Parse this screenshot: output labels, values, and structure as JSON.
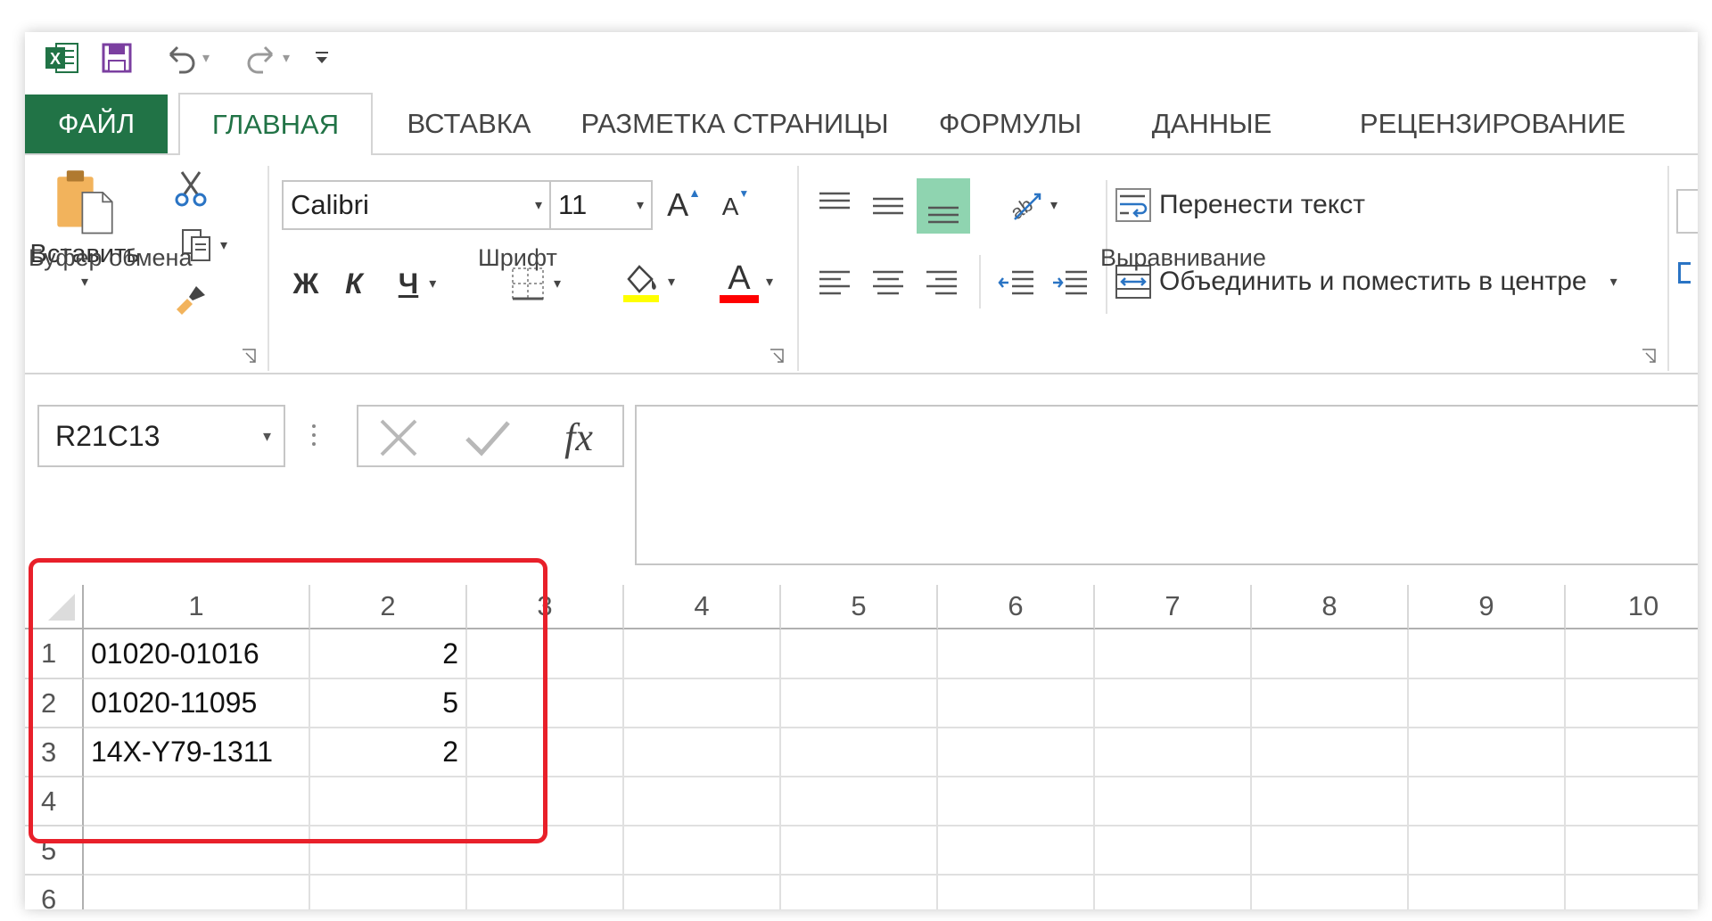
{
  "app": {
    "name": "Microsoft Excel"
  },
  "qat": {
    "icons": [
      "excel-icon",
      "save-icon",
      "undo-icon",
      "redo-icon",
      "customize-icon"
    ]
  },
  "tabs": [
    {
      "label": "ФАЙЛ"
    },
    {
      "label": "ГЛАВНАЯ"
    },
    {
      "label": "ВСТАВКА"
    },
    {
      "label": "РАЗМЕТКА СТРАНИЦЫ"
    },
    {
      "label": "ФОРМУЛЫ"
    },
    {
      "label": "ДАННЫЕ"
    },
    {
      "label": "РЕЦЕНЗИРОВАНИЕ"
    }
  ],
  "clipboard": {
    "paste_label": "Вставить",
    "group_label": "Буфер обмена"
  },
  "font": {
    "name": "Calibri",
    "size": "11",
    "grow_label": "A",
    "shrink_label": "A",
    "bold": "Ж",
    "italic": "К",
    "underline": "Ч",
    "font_color_label": "A",
    "group_label": "Шрифт"
  },
  "alignment": {
    "wrap_text": "Перенести текст",
    "merge_center": "Объединить и поместить в центре",
    "group_label": "Выравнивание"
  },
  "formula_bar": {
    "name_box": "R21C13",
    "fx": "fx",
    "value": ""
  },
  "sheet": {
    "columns": [
      "1",
      "2",
      "3",
      "4",
      "5",
      "6",
      "7",
      "8",
      "9",
      "10"
    ],
    "rows": [
      {
        "num": "1",
        "c1": "01020-01016",
        "c2": "2"
      },
      {
        "num": "2",
        "c1": "01020-11095",
        "c2": "5"
      },
      {
        "num": "3",
        "c1": "14X-Y79-1311",
        "c2": "2"
      },
      {
        "num": "4",
        "c1": "",
        "c2": ""
      },
      {
        "num": "5",
        "c1": "",
        "c2": ""
      },
      {
        "num": "6",
        "c1": "",
        "c2": ""
      }
    ]
  },
  "colors": {
    "excel_green": "#217346",
    "highlight": "#e8202a",
    "fill_yellow": "#ffff00",
    "font_red": "#ff0000"
  }
}
